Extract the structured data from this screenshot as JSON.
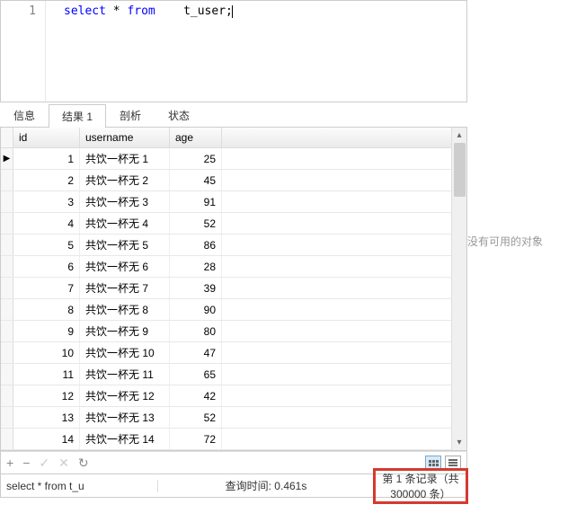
{
  "editor": {
    "line_number": "1",
    "sql_kw1": "select",
    "sql_star": "*",
    "sql_kw2": "from",
    "sql_table": "t_user;",
    "full": "select * from  t_user;"
  },
  "tabs": {
    "info": "信息",
    "result1": "结果 1",
    "profile": "剖析",
    "status": "状态"
  },
  "columns": {
    "id": "id",
    "username": "username",
    "age": "age"
  },
  "rows": [
    {
      "id": "1",
      "username": "共饮一杯无 1",
      "age": "25"
    },
    {
      "id": "2",
      "username": "共饮一杯无 2",
      "age": "45"
    },
    {
      "id": "3",
      "username": "共饮一杯无 3",
      "age": "91"
    },
    {
      "id": "4",
      "username": "共饮一杯无 4",
      "age": "52"
    },
    {
      "id": "5",
      "username": "共饮一杯无 5",
      "age": "86"
    },
    {
      "id": "6",
      "username": "共饮一杯无 6",
      "age": "28"
    },
    {
      "id": "7",
      "username": "共饮一杯无 7",
      "age": "39"
    },
    {
      "id": "8",
      "username": "共饮一杯无 8",
      "age": "90"
    },
    {
      "id": "9",
      "username": "共饮一杯无 9",
      "age": "80"
    },
    {
      "id": "10",
      "username": "共饮一杯无 10",
      "age": "47"
    },
    {
      "id": "11",
      "username": "共饮一杯无 11",
      "age": "65"
    },
    {
      "id": "12",
      "username": "共饮一杯无 12",
      "age": "42"
    },
    {
      "id": "13",
      "username": "共饮一杯无 13",
      "age": "52"
    },
    {
      "id": "14",
      "username": "共饮一杯无 14",
      "age": "72"
    }
  ],
  "side_panel": {
    "no_object": "没有可用的对象"
  },
  "toolbar_icons": {
    "add": "+",
    "remove": "−",
    "check": "✓",
    "close": "✕",
    "refresh": "↻"
  },
  "status": {
    "sql": "select * from  t_u",
    "query_time_label": "查询时间: 0.461s",
    "record_info": "第 1 条记录（共 300000 条）"
  }
}
